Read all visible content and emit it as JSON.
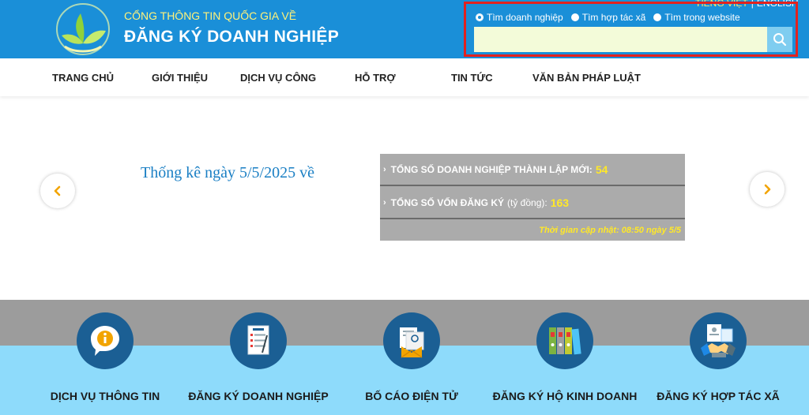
{
  "header": {
    "title_top": "CỔNG THÔNG TIN QUỐC GIA VỀ",
    "title_main": "ĐĂNG KÝ DOANH NGHIỆP",
    "lang_vi": "TIẾNG VIỆT",
    "lang_sep": "|",
    "lang_en": "ENGLISH"
  },
  "search": {
    "options": [
      {
        "label": "Tìm doanh nghiệp",
        "selected": true
      },
      {
        "label": "Tìm hợp tác xã",
        "selected": false
      },
      {
        "label": "Tìm trong website",
        "selected": false
      }
    ],
    "value": "",
    "placeholder": "",
    "icon": "search-icon"
  },
  "nav": {
    "items": [
      "TRANG CHỦ",
      "GIỚI THIỆU",
      "DỊCH VỤ CÔNG",
      "HỖ TRỢ",
      "TIN TỨC",
      "VĂN BẢN PHÁP LUẬT"
    ]
  },
  "stats": {
    "heading": "Thống kê ngày 5/5/2025 về",
    "rows": [
      {
        "label": "TỔNG SỐ DOANH NGHIỆP THÀNH LẬP MỚI:",
        "unit": "",
        "value": "54"
      },
      {
        "label": "TỔNG SỐ VỐN ĐĂNG KÝ",
        "unit": "(tỷ đồng):",
        "value": "163"
      }
    ],
    "update_text": "Thời gian cập nhật: 08:50 ngày 5/5",
    "prev_icon": "chevron-left-icon",
    "next_icon": "chevron-right-icon"
  },
  "services": [
    {
      "label": "DỊCH VỤ THÔNG TIN",
      "icon": "info-icon"
    },
    {
      "label": "ĐĂNG KÝ DOANH NGHIỆP",
      "icon": "document-icon"
    },
    {
      "label": "BỐ CÁO ĐIỆN TỬ",
      "icon": "email-icon"
    },
    {
      "label": "ĐĂNG KÝ HỘ KINH DOANH",
      "icon": "binders-icon"
    },
    {
      "label": "ĐĂNG KÝ HỢP TÁC XÃ",
      "icon": "handshake-icon"
    }
  ],
  "colors": {
    "header_bg": "#1a8fd8",
    "accent_yellow": "#ffe828",
    "search_highlight": "#e2221f",
    "service_band": "#8edbfb",
    "service_icon_bg": "#1b5f94"
  }
}
